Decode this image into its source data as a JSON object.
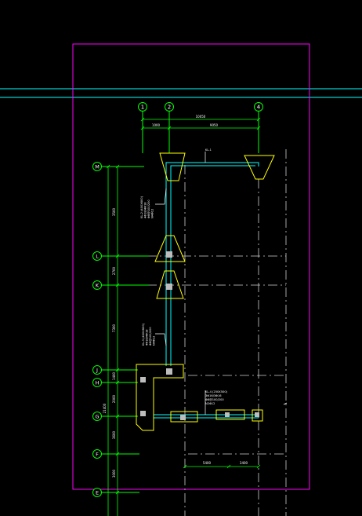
{
  "drawing": {
    "colors": {
      "background": "#000000",
      "frame": "#ff00ff",
      "axis": "#00ff00",
      "gridline": "#cfcfcf",
      "beam": "#00ffff",
      "footing": "#ffff00",
      "column": "#bdbdbd",
      "leader": "#ffffff"
    },
    "axes_top": [
      {
        "id": "top-1",
        "label": "1"
      },
      {
        "id": "top-2",
        "label": "2"
      },
      {
        "id": "top-4",
        "label": "4"
      }
    ],
    "axes_left": [
      {
        "id": "M",
        "label": "M"
      },
      {
        "id": "L",
        "label": "L"
      },
      {
        "id": "K",
        "label": "K"
      },
      {
        "id": "J",
        "label": "J"
      },
      {
        "id": "H",
        "label": "H"
      },
      {
        "id": "G",
        "label": "G"
      },
      {
        "id": "F",
        "label": "F"
      },
      {
        "id": "E",
        "label": "E"
      }
    ],
    "dims_top": {
      "total": "10050",
      "left": "1000",
      "right": "9050"
    },
    "dims_left": [
      "3500",
      "2700",
      "7300",
      "1400",
      "2000",
      "3600",
      "3000",
      "21400"
    ],
    "dims_bottom": [
      "5400",
      "3400"
    ],
    "notes": [
      {
        "id": "note-top",
        "lines": [
          "KL-1"
        ]
      },
      {
        "id": "note-upper",
        "lines": [
          "KL-2 (400X600)",
          "4Φ18/4Φ18",
          "Φ8@100/200",
          "N4Φ12"
        ]
      },
      {
        "id": "note-middle",
        "lines": [
          "KL-3 (400X600)",
          "4Φ18/4Φ18",
          "Φ8@100/200",
          "N4Φ12"
        ]
      },
      {
        "id": "note-lower",
        "lines": [
          "KL-4 (250X500)",
          "3Φ16/3Φ16",
          "Φ8@100/200",
          "N2Φ12"
        ]
      }
    ]
  }
}
